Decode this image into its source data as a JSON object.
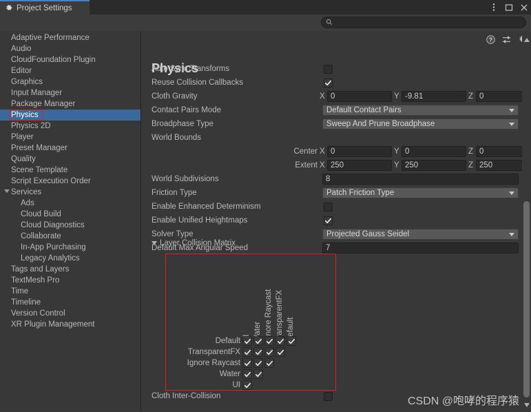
{
  "window": {
    "tab_label": "Project Settings",
    "tab_icon": "gear-icon",
    "controls": [
      "menu-kebab-icon",
      "maximize-icon",
      "close-icon"
    ]
  },
  "search": {
    "value": "",
    "placeholder": "",
    "icon": "search-icon"
  },
  "sidebar": {
    "items": [
      {
        "label": "Adaptive Performance",
        "level": 0,
        "selected": false,
        "foldout": false
      },
      {
        "label": "Audio",
        "level": 0,
        "selected": false,
        "foldout": false
      },
      {
        "label": "CloudFoundation Plugin",
        "level": 0,
        "selected": false,
        "foldout": false
      },
      {
        "label": "Editor",
        "level": 0,
        "selected": false,
        "foldout": false
      },
      {
        "label": "Graphics",
        "level": 0,
        "selected": false,
        "foldout": false
      },
      {
        "label": "Input Manager",
        "level": 0,
        "selected": false,
        "foldout": false
      },
      {
        "label": "Package Manager",
        "level": 0,
        "selected": false,
        "foldout": false
      },
      {
        "label": "Physics",
        "level": 0,
        "selected": true,
        "foldout": false
      },
      {
        "label": "Physics 2D",
        "level": 0,
        "selected": false,
        "foldout": false
      },
      {
        "label": "Player",
        "level": 0,
        "selected": false,
        "foldout": false
      },
      {
        "label": "Preset Manager",
        "level": 0,
        "selected": false,
        "foldout": false
      },
      {
        "label": "Quality",
        "level": 0,
        "selected": false,
        "foldout": false
      },
      {
        "label": "Scene Template",
        "level": 0,
        "selected": false,
        "foldout": false
      },
      {
        "label": "Script Execution Order",
        "level": 0,
        "selected": false,
        "foldout": false
      },
      {
        "label": "Services",
        "level": 0,
        "selected": false,
        "foldout": true
      },
      {
        "label": "Ads",
        "level": 1,
        "selected": false,
        "foldout": false
      },
      {
        "label": "Cloud Build",
        "level": 1,
        "selected": false,
        "foldout": false
      },
      {
        "label": "Cloud Diagnostics",
        "level": 1,
        "selected": false,
        "foldout": false
      },
      {
        "label": "Collaborate",
        "level": 1,
        "selected": false,
        "foldout": false
      },
      {
        "label": "In-App Purchasing",
        "level": 1,
        "selected": false,
        "foldout": false
      },
      {
        "label": "Legacy Analytics",
        "level": 1,
        "selected": false,
        "foldout": false
      },
      {
        "label": "Tags and Layers",
        "level": 0,
        "selected": false,
        "foldout": false
      },
      {
        "label": "TextMesh Pro",
        "level": 0,
        "selected": false,
        "foldout": false
      },
      {
        "label": "Time",
        "level": 0,
        "selected": false,
        "foldout": false
      },
      {
        "label": "Timeline",
        "level": 0,
        "selected": false,
        "foldout": false
      },
      {
        "label": "Version Control",
        "level": 0,
        "selected": false,
        "foldout": false
      },
      {
        "label": "XR Plugin Management",
        "level": 0,
        "selected": false,
        "foldout": false
      }
    ]
  },
  "main": {
    "title": "Physics",
    "header_icons": [
      "help-icon",
      "preset-icon",
      "gear-icon"
    ],
    "rows": [
      {
        "kind": "checkbox",
        "label": "Auto Sync Transforms",
        "checked": false
      },
      {
        "kind": "checkbox",
        "label": "Reuse Collision Callbacks",
        "checked": true
      },
      {
        "kind": "vector3",
        "label": "Cloth Gravity",
        "x": "0",
        "y": "-9.81",
        "z": "0"
      },
      {
        "kind": "dropdown",
        "label": "Contact Pairs Mode",
        "value": "Default Contact Pairs"
      },
      {
        "kind": "dropdown",
        "label": "Broadphase Type",
        "value": "Sweep And Prune Broadphase"
      },
      {
        "kind": "header",
        "label": "World Bounds"
      },
      {
        "kind": "vector3",
        "label": "Center",
        "label_align": "right",
        "x": "0",
        "y": "0",
        "z": "0"
      },
      {
        "kind": "vector3",
        "label": "Extent",
        "label_align": "right",
        "x": "250",
        "y": "250",
        "z": "250"
      },
      {
        "kind": "text",
        "label": "World Subdivisions",
        "value": "8"
      },
      {
        "kind": "dropdown",
        "label": "Friction Type",
        "value": "Patch Friction Type"
      },
      {
        "kind": "checkbox",
        "label": "Enable Enhanced Determinism",
        "checked": false
      },
      {
        "kind": "checkbox",
        "label": "Enable Unified Heightmaps",
        "checked": true
      },
      {
        "kind": "dropdown",
        "label": "Solver Type",
        "value": "Projected Gauss Seidel"
      },
      {
        "kind": "text",
        "label": "Default Max Angular Speed",
        "value": "7"
      }
    ],
    "layer_matrix": {
      "foldout_label": "Layer Collision Matrix",
      "expanded": true,
      "column_labels": [
        "UI",
        "Water",
        "Ignore Raycast",
        "TransparentFX",
        "Default"
      ],
      "row_labels": [
        "Default",
        "TransparentFX",
        "Ignore Raycast",
        "Water",
        "UI"
      ],
      "cells": [
        [
          true,
          true,
          true,
          true,
          true
        ],
        [
          true,
          true,
          true,
          true
        ],
        [
          true,
          true,
          true
        ],
        [
          true,
          true
        ],
        [
          true
        ]
      ],
      "highlight_color": "#e02020"
    },
    "bottom_row": {
      "kind": "checkbox",
      "label": "Cloth Inter-Collision",
      "checked": false
    }
  },
  "watermark": "CSDN @咆哮的程序猿",
  "scrollbar": {
    "up_icon": "triangle-up-icon",
    "down_icon": "triangle-down-icon"
  }
}
